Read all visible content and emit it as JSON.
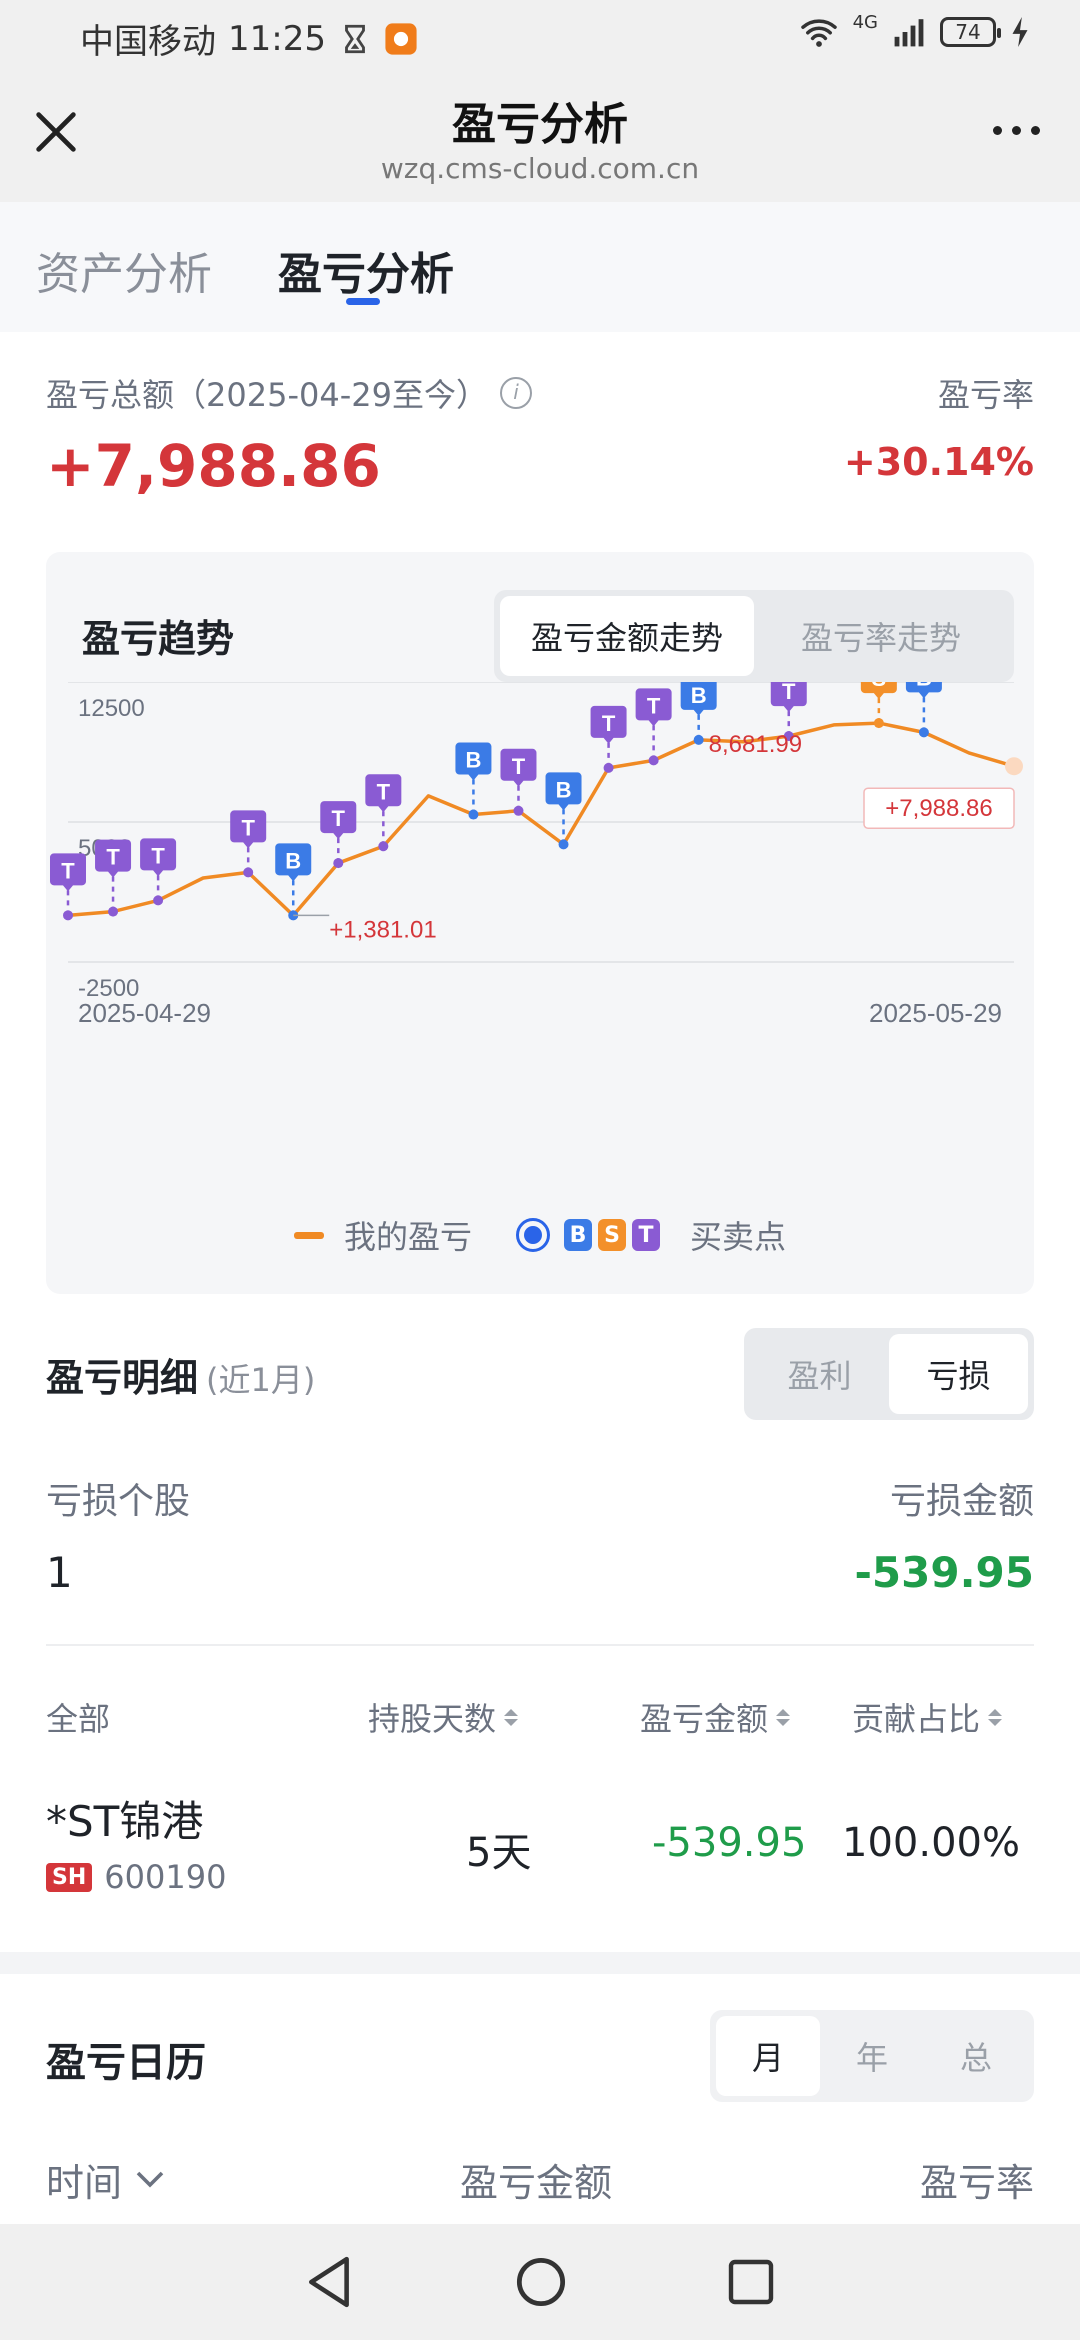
{
  "status": {
    "carrier": "中国移动",
    "time": "11:25",
    "network": "4G",
    "battery": "74"
  },
  "nav": {
    "title": "盈亏分析",
    "url": "wzq.cms-cloud.com.cn"
  },
  "tabs": [
    {
      "label": "资产分析"
    },
    {
      "label": "盈亏分析"
    }
  ],
  "summary": {
    "label": "盈亏总额（2025-04-29至今）",
    "rate_label": "盈亏率",
    "total": "+7,988.86",
    "rate": "+30.14%"
  },
  "trend": {
    "title": "盈亏趋势",
    "seg": [
      "盈亏金额走势",
      "盈亏率走势"
    ],
    "legend_profit": "我的盈亏",
    "legend_points": "买卖点"
  },
  "chart_data": {
    "type": "line",
    "title": "",
    "x_start": "2025-04-29",
    "x_end": "2025-05-29",
    "y_ticks": [
      12500,
      5000,
      -2500
    ],
    "ylim": [
      -2500,
      12500
    ],
    "series": [
      {
        "name": "我的盈亏",
        "values": [
          0,
          200,
          800,
          2000,
          2300,
          0,
          2800,
          3700,
          6400,
          5400,
          5600,
          3800,
          7900,
          8300,
          9400,
          9300,
          9600,
          10200,
          10300,
          9800,
          8700,
          7988.86
        ]
      }
    ],
    "markers": [
      {
        "index": 0,
        "type": "T"
      },
      {
        "index": 1,
        "type": "T"
      },
      {
        "index": 2,
        "type": "T"
      },
      {
        "index": 4,
        "type": "T"
      },
      {
        "index": 5,
        "type": "B"
      },
      {
        "index": 6,
        "type": "T"
      },
      {
        "index": 7,
        "type": "T"
      },
      {
        "index": 9,
        "type": "B"
      },
      {
        "index": 10,
        "type": "T"
      },
      {
        "index": 11,
        "type": "B"
      },
      {
        "index": 12,
        "type": "T"
      },
      {
        "index": 13,
        "type": "T"
      },
      {
        "index": 14,
        "type": "B"
      },
      {
        "index": 16,
        "type": "T"
      },
      {
        "index": 18,
        "type": "S"
      },
      {
        "index": 19,
        "type": "B"
      }
    ],
    "annotations": {
      "min": "+1,381.01",
      "max": "8,681.99",
      "last": "+7,988.86"
    },
    "colors": {
      "line": "#f08a24",
      "B": "#3b7be6",
      "S": "#f3902a",
      "T": "#8a5bd3"
    }
  },
  "detail": {
    "title": "盈亏明细",
    "period": "(近1月)",
    "seg": [
      "盈利",
      "亏损"
    ],
    "count_label": "亏损个股",
    "amount_label": "亏损金额",
    "count": "1",
    "amount": "-539.95",
    "headers": [
      "全部",
      "持股天数",
      "盈亏金额",
      "贡献占比"
    ],
    "rows": [
      {
        "name": "*ST锦港",
        "market": "SH",
        "code": "600190",
        "days": "5天",
        "amount": "-539.95",
        "pct": "100.00%"
      }
    ]
  },
  "calendar": {
    "title": "盈亏日历",
    "seg": [
      "月",
      "年",
      "总"
    ],
    "cols": [
      "时间",
      "盈亏金额",
      "盈亏率"
    ]
  }
}
